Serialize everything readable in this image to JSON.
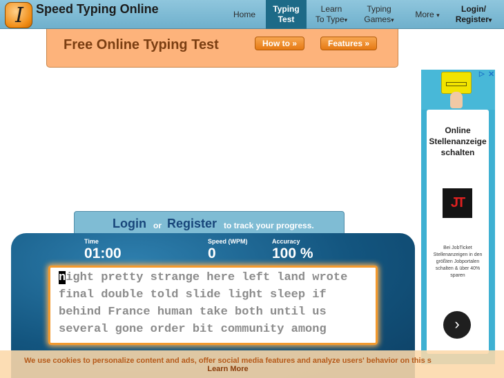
{
  "header": {
    "brand": "Speed Typing Online",
    "logo_icon": "italic-i-logo-icon",
    "nav": {
      "home": "Home",
      "typing_test_line1": "Typing",
      "typing_test_line2": "Test",
      "learn_line1": "Learn",
      "learn_line2": "To Type",
      "games_line1": "Typing",
      "games_line2": "Games",
      "more": "More",
      "login_line1": "Login/",
      "login_line2": "Register",
      "caret": "▾"
    }
  },
  "banner": {
    "title": "Free Online Typing Test",
    "how_to": "How to »",
    "features": "Features »"
  },
  "ad": {
    "adchoices": "▷",
    "close": "✕",
    "headline_line1": "Online",
    "headline_line2": "Stellenanzeige",
    "headline_line3": "schalten",
    "logo_text": "JT",
    "body": "Bei JobTicket Stellenanzeigen in den größten Jobportalen schalten & über 40% sparen",
    "arrow": "›"
  },
  "login_strip": {
    "login": "Login",
    "or": "or",
    "register": "Register",
    "note": "to track your progress."
  },
  "stats": {
    "time_label": "Time",
    "time_value": "01:00",
    "speed_label": "Speed (WPM)",
    "speed_value": "0",
    "accuracy_label": "Accuracy",
    "accuracy_value": "100 %"
  },
  "typing": {
    "cursor_char": "n",
    "line1_rest": "ight pretty strange here left land wrote",
    "line2": "final double told slide light sleep if",
    "line3": "behind France human take both until us",
    "line4": "several gone order bit community among"
  },
  "cookie": {
    "text": "We use cookies to personalize content and ads, offer social media features and analyze users' behavior on this s",
    "learn_more": "Learn More"
  },
  "colors": {
    "nav_bg": "#7fbcd4",
    "nav_active": "#1d6a87",
    "banner_bg": "#fdb37b",
    "panel_bg": "#13557f",
    "typebox_border": "#f39a2e",
    "ad_bg": "#3eb0d2"
  }
}
